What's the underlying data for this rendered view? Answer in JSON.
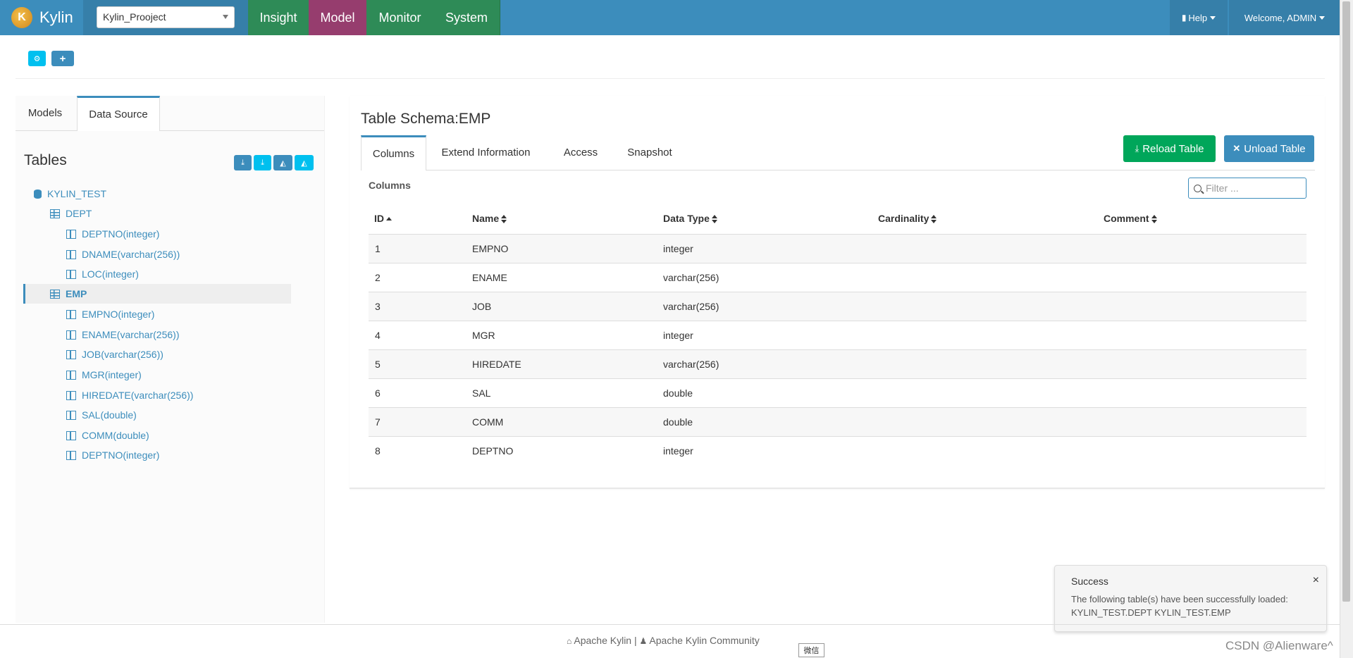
{
  "app": {
    "brand": "Kylin",
    "logo_glyph": "K"
  },
  "project": {
    "selected": "Kylin_Prooject"
  },
  "nav": {
    "insight": "Insight",
    "model": "Model",
    "monitor": "Monitor",
    "system": "System",
    "help": "Help",
    "welcome": "Welcome, ADMIN"
  },
  "colors": {
    "topbar": "#3c8dbc",
    "insight": "#2e8b57",
    "model": "#963d6e",
    "green_btn": "#00a65a",
    "blue_btn": "#3c8dbc",
    "cyan_btn": "#00c0ef"
  },
  "toolbar": {
    "btn1_icon": "cubes-icon",
    "btn2_icon": "plus-icon"
  },
  "sidebar": {
    "tabs": [
      "Models",
      "Data Source"
    ],
    "tables_title": "Tables",
    "database": "KYLIN_TEST",
    "tables": [
      {
        "name": "DEPT",
        "columns": [
          "DEPTNO(integer)",
          "DNAME(varchar(256))",
          "LOC(integer)"
        ]
      },
      {
        "name": "EMP",
        "columns": [
          "EMPNO(integer)",
          "ENAME(varchar(256))",
          "JOB(varchar(256))",
          "MGR(integer)",
          "HIREDATE(varchar(256))",
          "SAL(double)",
          "COMM(double)",
          "DEPTNO(integer)"
        ]
      }
    ]
  },
  "main": {
    "title": "Table Schema:EMP",
    "tabs": [
      "Columns",
      "Extend Information",
      "Access",
      "Snapshot"
    ],
    "reload_label": "Reload Table",
    "unload_label": "Unload Table",
    "columns_label": "Columns",
    "filter_placeholder": "Filter ...",
    "headers": [
      "ID",
      "Name",
      "Data Type",
      "Cardinality",
      "Comment"
    ],
    "rows": [
      {
        "id": "1",
        "name": "EMPNO",
        "type": "integer"
      },
      {
        "id": "2",
        "name": "ENAME",
        "type": "varchar(256)"
      },
      {
        "id": "3",
        "name": "JOB",
        "type": "varchar(256)"
      },
      {
        "id": "4",
        "name": "MGR",
        "type": "integer"
      },
      {
        "id": "5",
        "name": "HIREDATE",
        "type": "varchar(256)"
      },
      {
        "id": "6",
        "name": "SAL",
        "type": "double"
      },
      {
        "id": "7",
        "name": "COMM",
        "type": "double"
      },
      {
        "id": "8",
        "name": "DEPTNO",
        "type": "integer"
      }
    ]
  },
  "toast": {
    "title": "Success",
    "message": "The following table(s) have been successfully loaded: KYLIN_TEST.DEPT KYLIN_TEST.EMP",
    "close": "×"
  },
  "footer": {
    "apache_kylin": "Apache Kylin",
    "separator": "|",
    "community": "Apache Kylin Community",
    "wechat": "微信",
    "watermark": "CSDN @Alienware^"
  }
}
